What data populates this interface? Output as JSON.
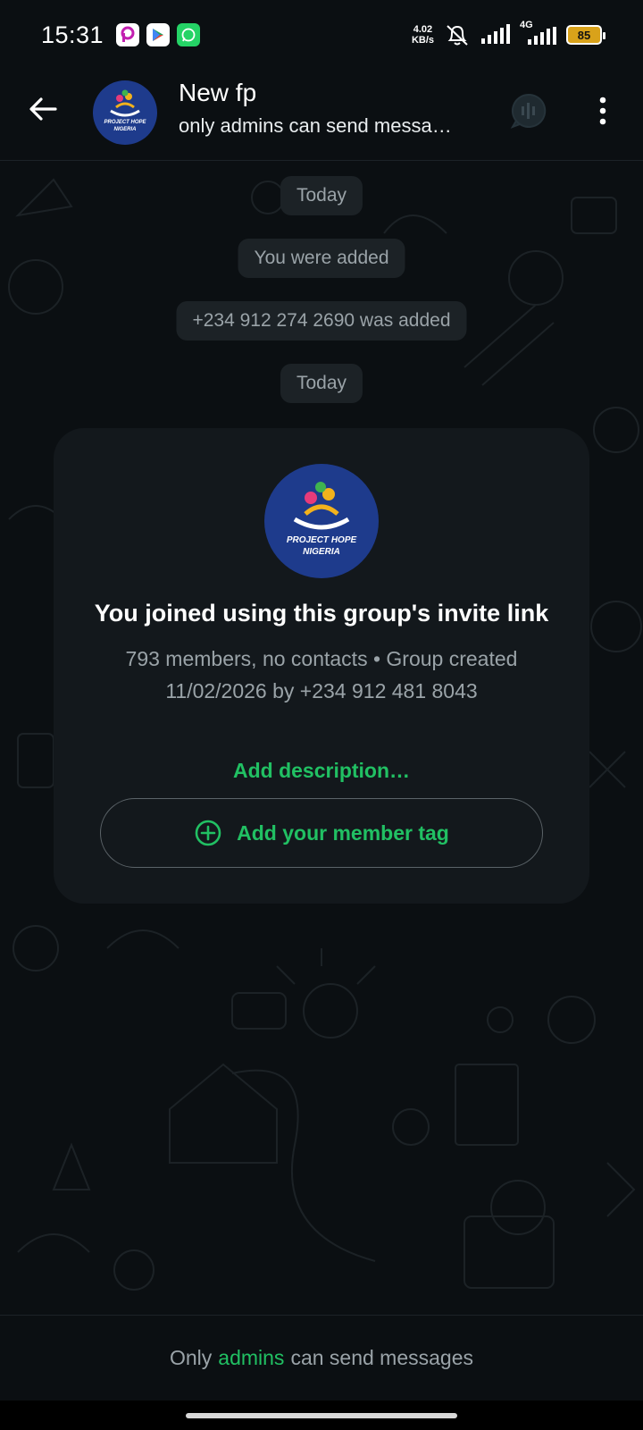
{
  "status_bar": {
    "time": "15:31",
    "net_speed_value": "4.02",
    "net_speed_unit": "KB/s",
    "network": "4G",
    "battery": "85",
    "battery_color": "#d9a21a"
  },
  "header": {
    "title": "New fp",
    "subtitle": "only admins can send messa…",
    "avatar_text_line1": "PROJECT HOPE",
    "avatar_text_line2": "NIGERIA"
  },
  "chat": {
    "pills": [
      "Today",
      "You were added",
      "+234 912 274 2690 was added",
      "Today"
    ]
  },
  "card": {
    "logo_line1": "PROJECT HOPE",
    "logo_line2": "NIGERIA",
    "title": "You joined using this group's invite link",
    "meta": "793 members, no contacts • Group created 11/02/2026 by +234 912 481 8043",
    "add_description": "Add description…",
    "member_tag_button": "Add your member tag"
  },
  "footer": {
    "prefix": "Only",
    "highlight": "admins",
    "suffix": "can send messages"
  },
  "colors": {
    "accent": "#21c063",
    "background": "#0b0f12",
    "card": "#13181c"
  }
}
